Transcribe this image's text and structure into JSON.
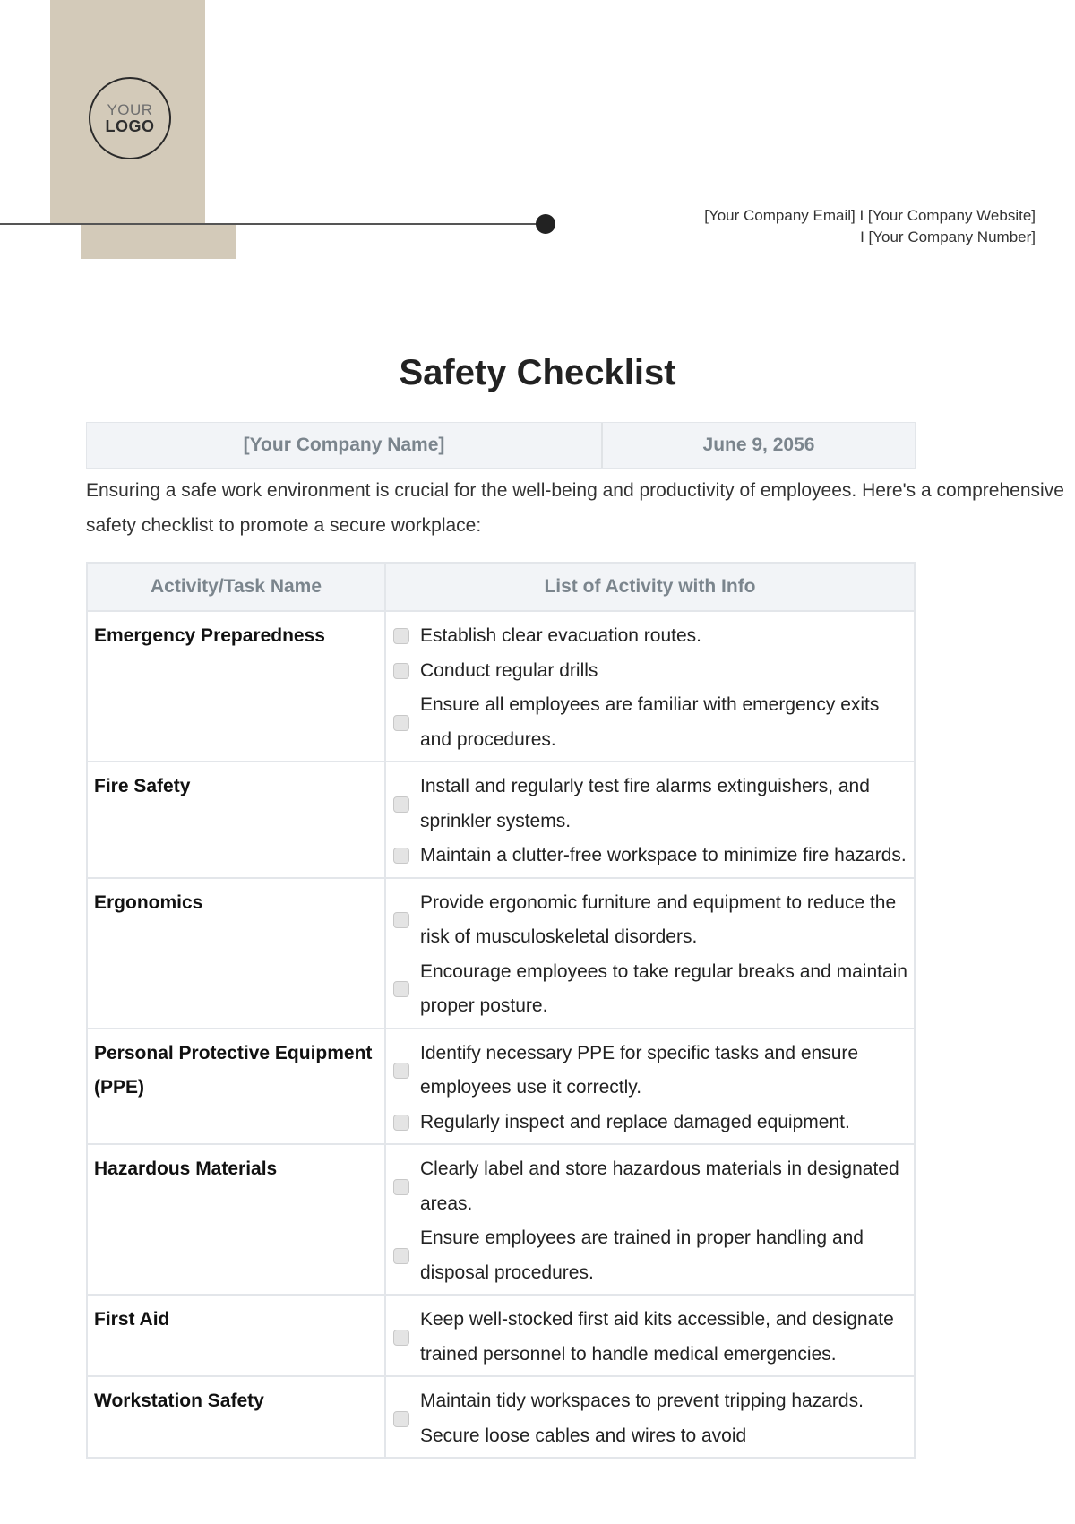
{
  "logo": {
    "line1": "YOUR",
    "line2": "LOGO"
  },
  "contact": {
    "line1": "[Your Company Email] I [Your Company Website]",
    "line2": "I [Your Company Number]"
  },
  "title": "Safety Checklist",
  "info": {
    "company": "[Your Company Name]",
    "date": "June 9, 2056"
  },
  "intro": "Ensuring a safe work environment is crucial for the well-being and productivity of employees. Here's a comprehensive safety checklist to promote a secure workplace:",
  "table": {
    "headers": [
      "Activity/Task Name",
      "List of Activity with Info"
    ],
    "rows": [
      {
        "name": "Emergency Preparedness",
        "items": [
          "Establish clear evacuation routes.",
          "Conduct regular drills",
          "Ensure all employees are familiar with emergency exits and procedures."
        ]
      },
      {
        "name": "Fire Safety",
        "items": [
          "Install and regularly test fire alarms extinguishers, and sprinkler systems.",
          "Maintain a clutter-free workspace to minimize fire hazards."
        ]
      },
      {
        "name": "Ergonomics",
        "items": [
          "Provide ergonomic furniture and equipment to reduce the risk of musculoskeletal disorders.",
          "Encourage employees to take regular breaks and maintain proper posture."
        ]
      },
      {
        "name": "Personal Protective Equipment (PPE)",
        "items": [
          "Identify necessary PPE for specific tasks and ensure employees use it correctly.",
          "Regularly inspect and replace damaged equipment."
        ]
      },
      {
        "name": "Hazardous Materials",
        "items": [
          "Clearly label and store hazardous materials in designated areas.",
          "Ensure employees are trained in proper handling and disposal procedures."
        ]
      },
      {
        "name": "First Aid",
        "items": [
          "Keep well-stocked first aid kits accessible, and designate trained personnel to handle medical emergencies."
        ]
      },
      {
        "name": "Workstation Safety",
        "items": [
          "Maintain tidy workspaces to prevent tripping hazards. Secure loose cables and wires to avoid"
        ]
      }
    ]
  }
}
